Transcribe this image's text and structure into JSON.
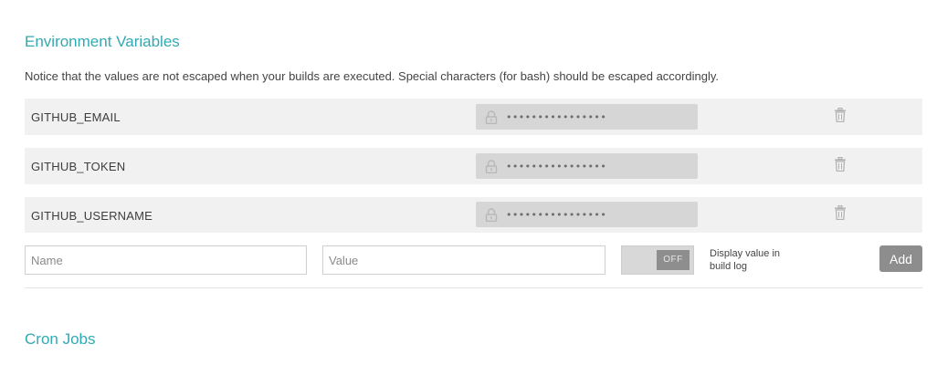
{
  "env_section": {
    "title": "Environment Variables",
    "notice": "Notice that the values are not escaped when your builds are executed. Special characters (for bash) should be escaped accordingly.",
    "variables": [
      {
        "name": "GITHUB_EMAIL",
        "value_masked": "••••••••••••••••"
      },
      {
        "name": "GITHUB_TOKEN",
        "value_masked": "••••••••••••••••"
      },
      {
        "name": "GITHUB_USERNAME",
        "value_masked": "••••••••••••••••"
      }
    ]
  },
  "add_form": {
    "name_placeholder": "Name",
    "value_placeholder": "Value",
    "toggle_state": "OFF",
    "toggle_label": "Display value in build log",
    "add_label": "Add"
  },
  "cron_section": {
    "title": "Cron Jobs"
  },
  "icons": {
    "lock": "lock-icon",
    "delete": "trash-icon"
  },
  "colors": {
    "accent": "#32a9b3",
    "row_bg": "#f1f1f1",
    "masked_bg": "#d6d6d6",
    "button_bg": "#8d8d8d"
  }
}
